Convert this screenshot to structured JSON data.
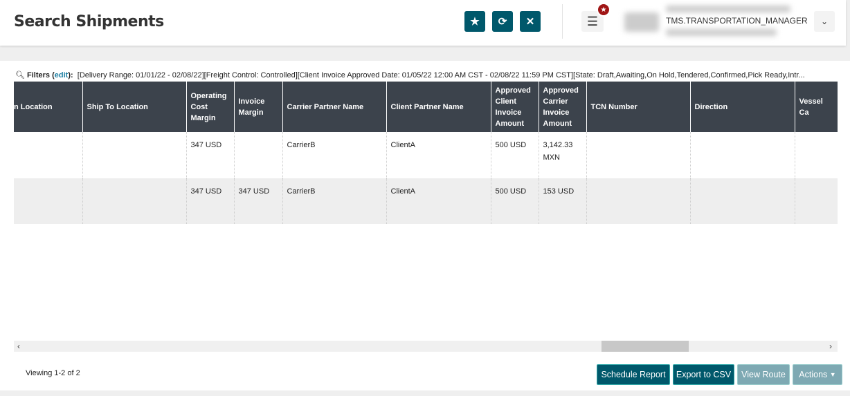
{
  "header": {
    "title": "Search Shipments",
    "role": "TMS.TRANSPORTATION_MANAGER"
  },
  "filters": {
    "label": "Filters",
    "edit": "edit",
    "text": "[Delivery Range: 01/01/22 - 02/08/22][Freight Control: Controlled][Client Invoice Approved Date: 01/05/22 12:00 AM CST - 02/08/22 11:59 PM CST][State: Draft,Awaiting,On Hold,Tendered,Confirmed,Pick Ready,Intr..."
  },
  "columns": [
    "n Location",
    "Ship To Location",
    "Operating Cost Margin",
    "Invoice Margin",
    "Carrier Partner Name",
    "Client Partner Name",
    "Approved Client Invoice Amount",
    "Approved Carrier Invoice Amount",
    "TCN Number",
    "Direction",
    "Vessel Ca"
  ],
  "rows": [
    [
      "",
      "",
      "347 USD",
      "",
      "CarrierB",
      "ClientA",
      "500 USD",
      "3,142.33 MXN",
      "",
      "",
      ""
    ],
    [
      "",
      "",
      "347 USD",
      "347 USD",
      "CarrierB",
      "ClientA",
      "500 USD",
      "153 USD",
      "",
      "",
      ""
    ]
  ],
  "footer": {
    "viewing": "Viewing 1-2 of 2",
    "schedule": "Schedule Report",
    "export": "Export to CSV",
    "route": "View Route",
    "actions": "Actions"
  }
}
